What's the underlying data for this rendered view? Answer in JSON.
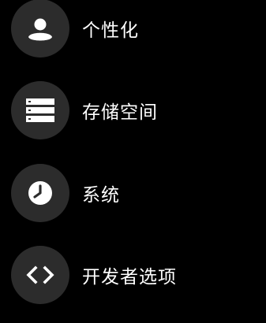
{
  "settings": {
    "items": [
      {
        "label": "个性化",
        "icon": "person-icon"
      },
      {
        "label": "存储空间",
        "icon": "storage-icon"
      },
      {
        "label": "系统",
        "icon": "clock-icon"
      },
      {
        "label": "开发者选项",
        "icon": "code-icon"
      }
    ]
  },
  "colors": {
    "background": "#000000",
    "icon_circle": "#2c2c2c",
    "icon_glyph": "#ffffff",
    "text": "#ffffff"
  }
}
